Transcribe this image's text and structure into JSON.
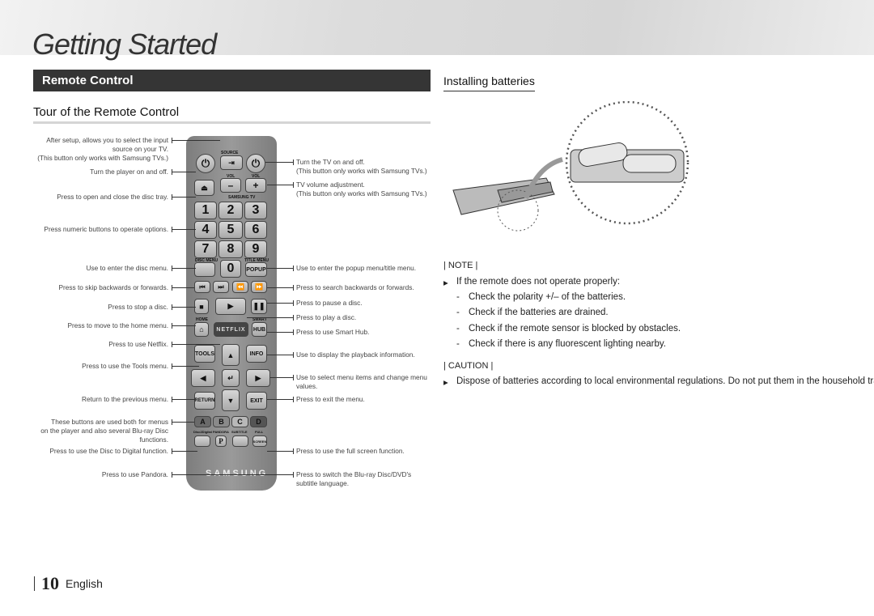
{
  "header": {
    "title": "Getting Started"
  },
  "section": {
    "title": "Remote Control",
    "subtitle": "Tour of the Remote Control"
  },
  "batteries": {
    "title": "Installing batteries"
  },
  "left_labels": [
    "After setup, allows you to select the input\nsource on your TV.\n(This button only works with Samsung TVs.)",
    "Turn the player on and off.",
    "Press to open and close the disc tray.",
    "Press numeric buttons to operate options.",
    "Use to enter the disc menu.",
    "Press to skip backwards or forwards.",
    "Press to stop a disc.",
    "Press to move to the home menu.",
    "Press to use Netflix.",
    "Press to use the Tools menu.",
    "Return to the previous menu.",
    "These buttons are used both for menus\non the player and also several Blu-ray Disc\nfunctions.",
    "Press to use the Disc to Digital function.",
    "Press to use Pandora."
  ],
  "right_labels": [
    "Turn the TV on and off.\n(This button only works with Samsung TVs.)",
    "TV volume adjustment.\n(This button only works with Samsung TVs.)",
    "Use to enter the popup menu/title menu.",
    "Press to search backwards or forwards.",
    "Press to pause a disc.",
    "Press to play a disc.",
    "Press to use Smart Hub.",
    "Use to display the playback information.",
    "Use to select menu items and change menu\nvalues.",
    "Press to exit the menu.",
    "Press to use the full screen function.",
    "Press to switch the Blu-ray Disc/DVD's\nsubtitle language."
  ],
  "remote": {
    "source": "SOURCE",
    "vol": "VOL",
    "samsung_tv": "SAMSUNG TV",
    "minus": "–",
    "plus": "+",
    "digits": [
      "1",
      "2",
      "3",
      "4",
      "5",
      "6",
      "7",
      "8",
      "9",
      "0"
    ],
    "disc_menu": "DISC MENU",
    "title_menu": "TITLE MENU",
    "popup": "POPUP",
    "home": "HOME",
    "smart": "SMART",
    "hub": "HUB",
    "netflix": "NETFLIX",
    "tools": "TOOLS",
    "info": "INFO",
    "return": "RETURN",
    "exit": "EXIT",
    "colors": [
      "A",
      "B",
      "C",
      "D"
    ],
    "color_fills": [
      "#6a6a6a",
      "#8a8a8a",
      "#b8b8b8",
      "#555555"
    ],
    "disc2digital": "Disc2Digital",
    "pandora": "PANDORA",
    "pandora_p": "P",
    "subtitle": "SUBTITLE",
    "full": "FULL",
    "screen": "SCREEN",
    "brand": "SAMSUNG"
  },
  "note": {
    "heading": "| NOTE |",
    "bullet": "If the remote does not operate properly:",
    "items": [
      "Check the polarity +/– of the batteries.",
      "Check if the batteries are drained.",
      "Check if the remote sensor is blocked by obstacles.",
      "Check if there is any fluorescent lighting nearby."
    ]
  },
  "caution": {
    "heading": "| CAUTION |",
    "bullet": "Dispose of batteries according to local environmental regulations. Do not put them in the household trash."
  },
  "footer": {
    "page": "10",
    "lang": "English"
  }
}
